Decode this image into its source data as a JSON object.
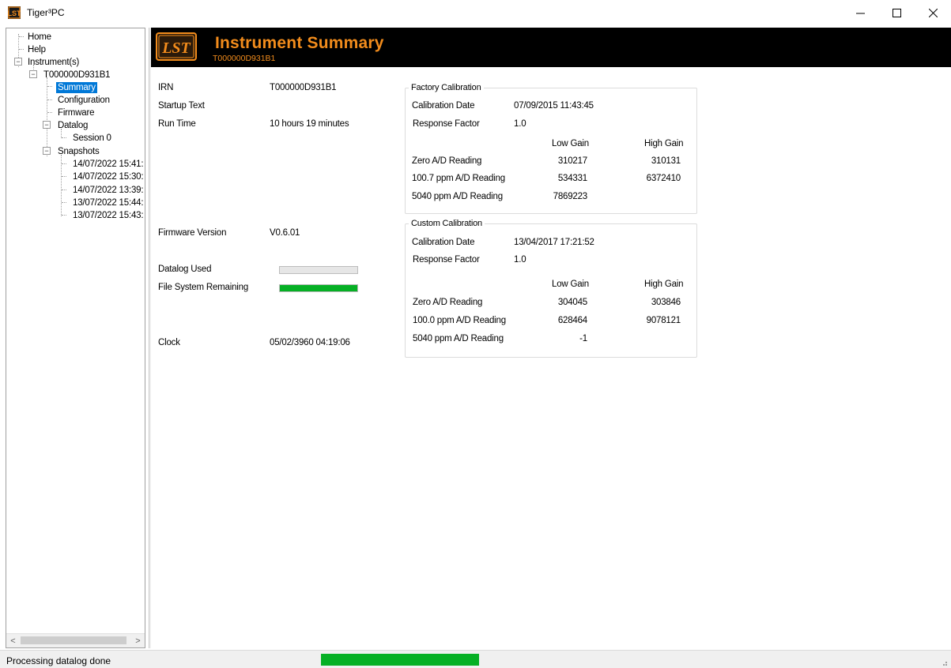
{
  "window": {
    "title": "Tiger³PC",
    "app_icon": "lst-logo-icon",
    "controls": [
      "minimize-icon",
      "maximize-icon",
      "close-icon"
    ]
  },
  "tree": {
    "home": "Home",
    "help": "Help",
    "instruments": "Instrument(s)",
    "instrument_id": "T000000D931B1",
    "summary": "Summary",
    "configuration": "Configuration",
    "firmware": "Firmware",
    "datalog": "Datalog",
    "session": "Session 0",
    "snapshots": "Snapshots",
    "snapshot_items": [
      "14/07/2022 15:41:",
      "14/07/2022 15:30:",
      "14/07/2022 13:39:",
      "13/07/2022 15:44:",
      "13/07/2022 15:43:"
    ],
    "collapse_glyph": "−",
    "scroll_left": "<",
    "scroll_right": ">"
  },
  "header": {
    "title": "Instrument Summary",
    "subtitle": "T000000D931B1",
    "logo_text": "LST",
    "band_color": "#000000",
    "accent_color": "#f28c1c"
  },
  "summary": {
    "irn_label": "IRN",
    "irn_value": "T000000D931B1",
    "startup_label": "Startup Text",
    "startup_value": "",
    "runtime_label": "Run Time",
    "runtime_value": "10  hours 19 minutes",
    "firmware_label": "Firmware Version",
    "firmware_value": "V0.6.01",
    "datalog_label": "Datalog Used",
    "datalog_used_fraction": 0.0,
    "filesystem_label": "File System Remaining",
    "filesystem_remaining_fraction": 1.0,
    "clock_label": "Clock",
    "clock_value": "05/02/3960 04:19:06",
    "progress_color": "#06b025"
  },
  "factory": {
    "legend": "Factory Calibration",
    "cal_date_label": "Calibration Date",
    "cal_date_value": "07/09/2015 11:43:45",
    "response_label": "Response Factor",
    "response_value": "1.0",
    "low_gain": "Low Gain",
    "high_gain": "High Gain",
    "rows": [
      {
        "label": "Zero A/D Reading",
        "low": "310217",
        "high": "310131"
      },
      {
        "label": "100.7 ppm A/D Reading",
        "low": "534331",
        "high": "6372410"
      },
      {
        "label": "5040 ppm A/D Reading",
        "low": "7869223",
        "high": ""
      }
    ]
  },
  "custom": {
    "legend": "Custom Calibration",
    "cal_date_label": "Calibration Date",
    "cal_date_value": "13/04/2017 17:21:52",
    "response_label": "Response Factor",
    "response_value": "1.0",
    "low_gain": "Low Gain",
    "high_gain": "High Gain",
    "rows": [
      {
        "label": "Zero A/D Reading",
        "low": "304045",
        "high": "303846"
      },
      {
        "label": "100.0 ppm A/D Reading",
        "low": "628464",
        "high": "9078121"
      },
      {
        "label": "5040 ppm A/D Reading",
        "low": "-1",
        "high": ""
      }
    ]
  },
  "status": {
    "text": "Processing datalog done",
    "progress_fraction": 1.0,
    "grip_icon": "resize-grip-icon"
  }
}
